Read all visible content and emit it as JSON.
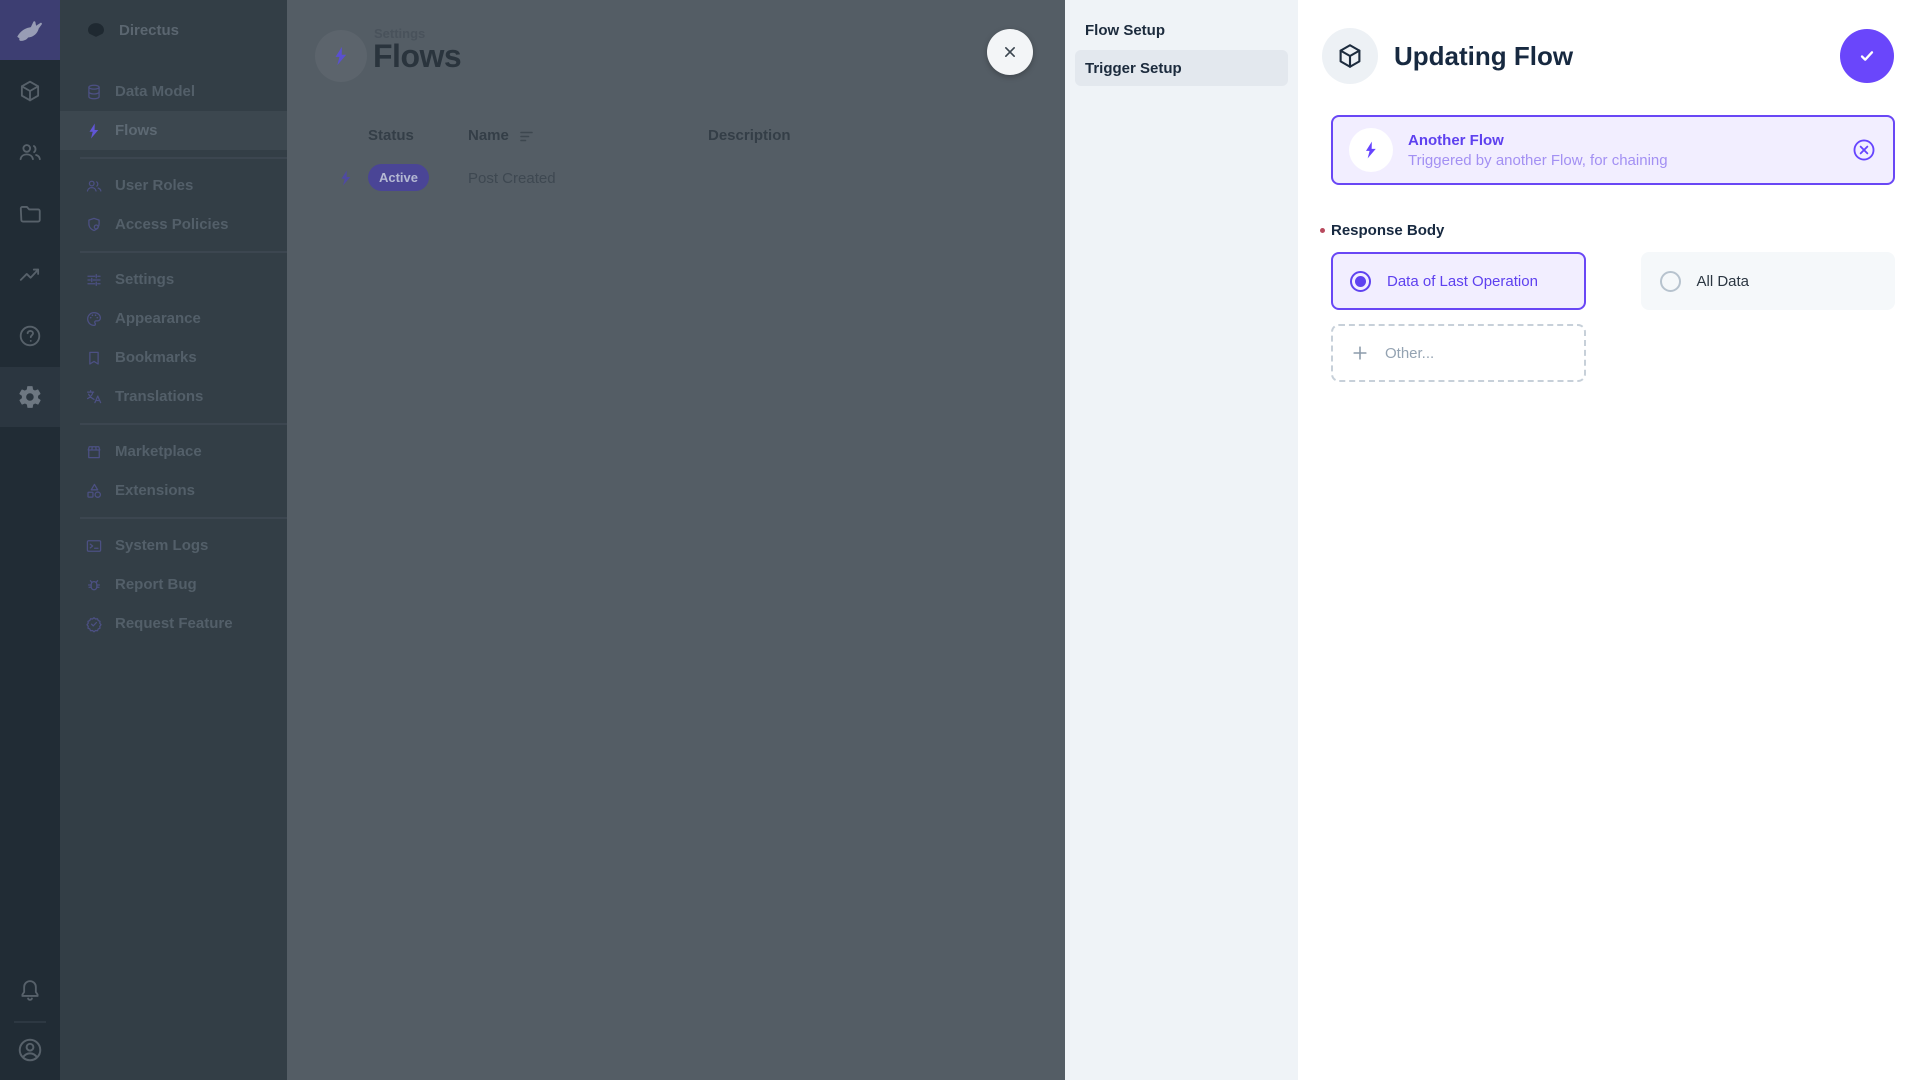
{
  "brand": {
    "name": "Directus"
  },
  "sidebar": {
    "project_name": "Directus",
    "sections": [
      [
        {
          "icon": "database",
          "label": "Data Model"
        },
        {
          "icon": "bolt",
          "label": "Flows",
          "active": true
        }
      ],
      [
        {
          "icon": "people",
          "label": "User Roles"
        },
        {
          "icon": "shield",
          "label": "Access Policies"
        }
      ],
      [
        {
          "icon": "tune",
          "label": "Settings"
        },
        {
          "icon": "palette",
          "label": "Appearance"
        },
        {
          "icon": "bookmark",
          "label": "Bookmarks"
        },
        {
          "icon": "translate",
          "label": "Translations"
        }
      ],
      [
        {
          "icon": "storefront",
          "label": "Marketplace"
        },
        {
          "icon": "category",
          "label": "Extensions"
        }
      ],
      [
        {
          "icon": "terminal",
          "label": "System Logs"
        },
        {
          "icon": "bug",
          "label": "Report Bug"
        },
        {
          "icon": "verified",
          "label": "Request Feature"
        }
      ]
    ]
  },
  "main": {
    "breadcrumb": "Settings",
    "title": "Flows",
    "table": {
      "columns": [
        "Status",
        "Name",
        "Description"
      ],
      "rows": [
        {
          "status": "Active",
          "name": "Post Created",
          "description": ""
        }
      ]
    }
  },
  "drawer": {
    "nav": [
      {
        "label": "Flow Setup",
        "active": false
      },
      {
        "label": "Trigger Setup",
        "active": true
      }
    ],
    "title": "Updating Flow",
    "trigger_card": {
      "title": "Another Flow",
      "subtitle": "Triggered by another Flow, for chaining"
    },
    "response_body": {
      "label": "Response Body",
      "required": true,
      "options": [
        {
          "label": "Data of Last Operation",
          "selected": true
        },
        {
          "label": "All Data",
          "selected": false
        }
      ],
      "other": "Other..."
    }
  },
  "colors": {
    "accent": "#6644ff",
    "accent_soft_bg": "#f2eeff",
    "drawer_nav_bg": "#eff3f7",
    "status_active_pill": "#6644ff",
    "text_dark": "#172940",
    "module_bar_bg": "#212c35",
    "sidebar_bg": "#333e46"
  }
}
